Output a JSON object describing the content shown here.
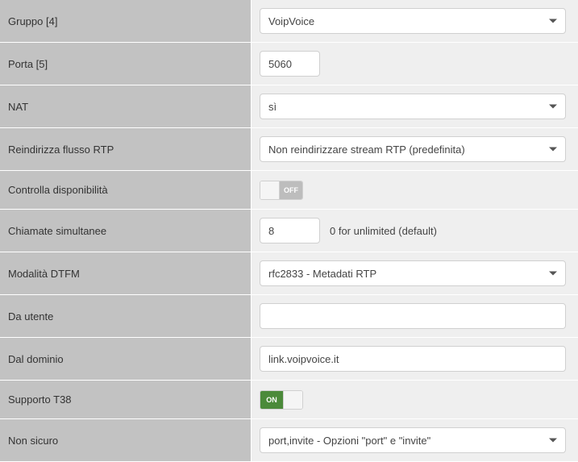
{
  "rows": {
    "gruppo": {
      "label": "Gruppo [4]",
      "value": "VoipVoice"
    },
    "porta": {
      "label": "Porta [5]",
      "value": "5060"
    },
    "nat": {
      "label": "NAT",
      "value": "sì"
    },
    "rtp": {
      "label": "Reindirizza flusso RTP",
      "value": "Non reindirizzare stream RTP (predefinita)"
    },
    "avail": {
      "label": "Controlla disponibilità",
      "state": "off",
      "state_label": "OFF"
    },
    "calls": {
      "label": "Chiamate simultanee",
      "value": "8",
      "hint": "0 for unlimited (default)"
    },
    "dtmf": {
      "label": "Modalità DTFM",
      "value": "rfc2833 - Metadati RTP"
    },
    "fromuser": {
      "label": "Da utente",
      "value": ""
    },
    "fromdom": {
      "label": "Dal dominio",
      "value": "link.voipvoice.it"
    },
    "t38": {
      "label": "Supporto T38",
      "state": "on",
      "state_label": "ON"
    },
    "insecure": {
      "label": "Non sicuro",
      "value": "port,invite - Opzioni \"port\" e \"invite\""
    }
  }
}
